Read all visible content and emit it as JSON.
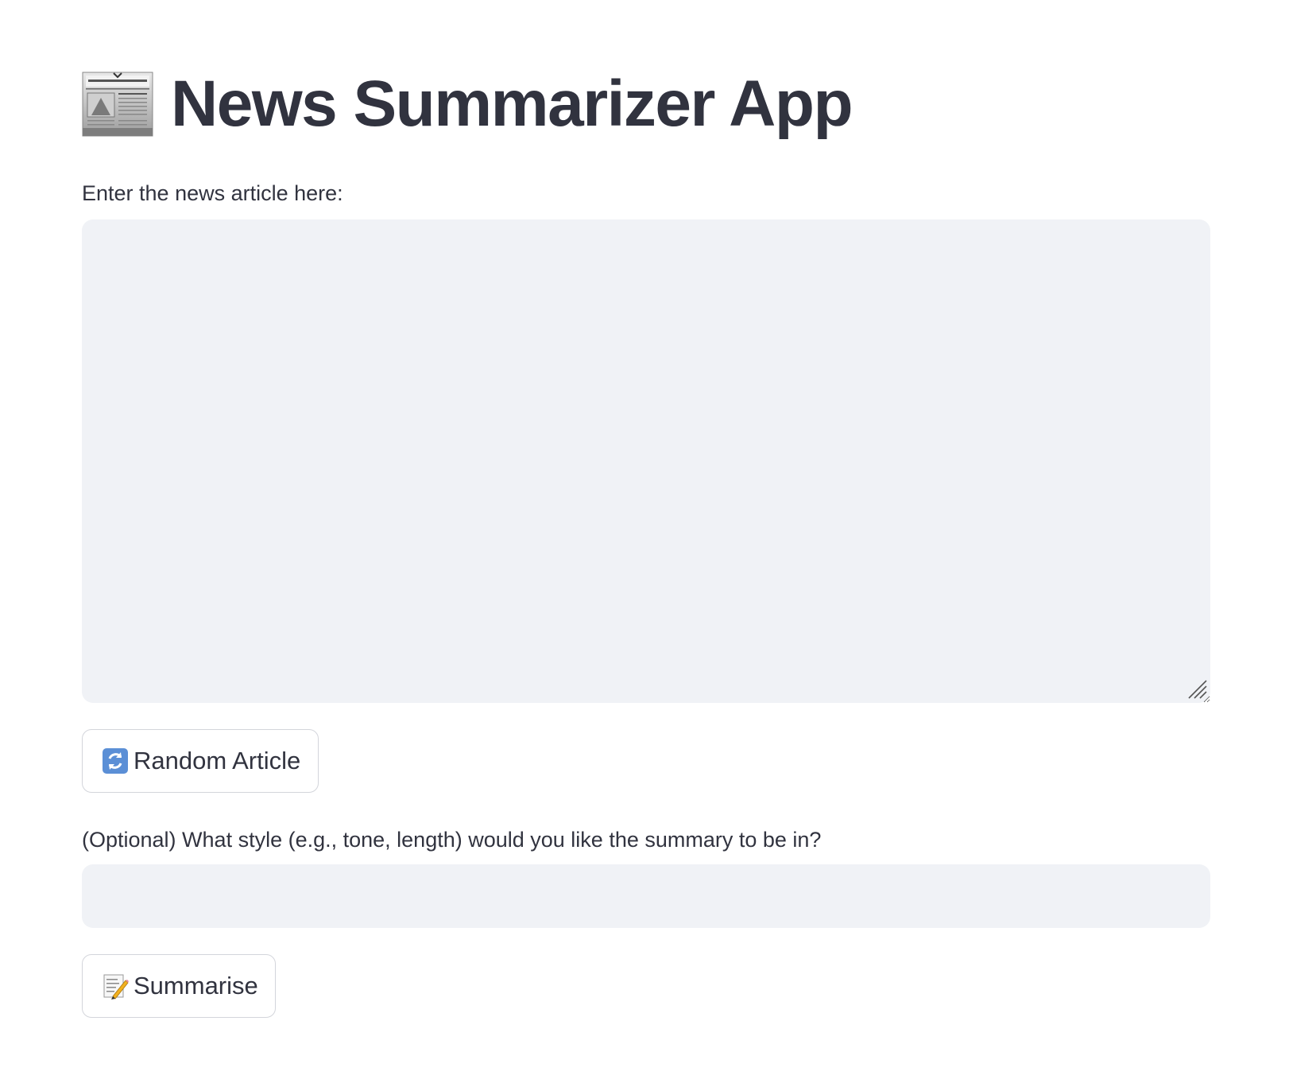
{
  "app": {
    "title": "News Summarizer App",
    "title_icon": "newspaper-icon"
  },
  "article_input": {
    "label": "Enter the news article here:",
    "value": "",
    "placeholder": ""
  },
  "random_button": {
    "label": "Random Article",
    "icon": "refresh-icon"
  },
  "style_input": {
    "label": "(Optional) What style (e.g., tone, length) would you like the summary to be in?",
    "value": "",
    "placeholder": ""
  },
  "summarise_button": {
    "label": "Summarise",
    "icon": "memo-icon"
  },
  "colors": {
    "text": "#31333f",
    "input_background": "#f0f2f6",
    "button_border": "#d3d5db",
    "background": "#ffffff"
  }
}
